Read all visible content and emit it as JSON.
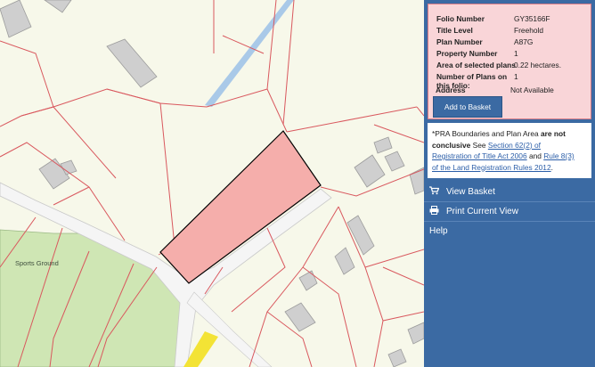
{
  "map": {
    "place_label": "Sports Ground",
    "colors": {
      "background": "#f7f8ea",
      "parcel_line": "#d9585e",
      "selected_fill": "#f5aeab",
      "selected_stroke": "#000000",
      "green_area": "#cfe6b4",
      "road": "#f5f5f5",
      "building": "#cfcfcf",
      "canal": "#a9c9e8",
      "yellow_road": "#f3e335"
    }
  },
  "folio": {
    "rows": [
      {
        "label": "Folio Number",
        "value": "GY35166F"
      },
      {
        "label": "Title Level",
        "value": "Freehold"
      },
      {
        "label": "Plan Number",
        "value": "A87G"
      },
      {
        "label": "Property Number",
        "value": "1"
      },
      {
        "label": "Area of selected plans",
        "value": "0.22 hectares."
      },
      {
        "label": "Number of Plans on",
        "label2": "this folio:",
        "value": "1"
      },
      {
        "label": "Address",
        "value": "Not Available"
      }
    ],
    "add_button": "Add to Basket"
  },
  "notice": {
    "prefix": "*PRA Boundaries and Plan Area",
    "bold1": "are not",
    "bold2": "conclusive",
    "see": "See",
    "link1a": "Section 62(2) of",
    "link1b": "Registration of Title Act 2006",
    "and": "and",
    "link2a": "Rule 8(3)",
    "link2b": "of the Land Registration Rules 2012",
    "end": "."
  },
  "menu": {
    "view_basket": "View Basket",
    "print_view": "Print Current View",
    "help": "Help"
  },
  "icons": {
    "basket": "cart-icon",
    "print": "printer-icon"
  }
}
